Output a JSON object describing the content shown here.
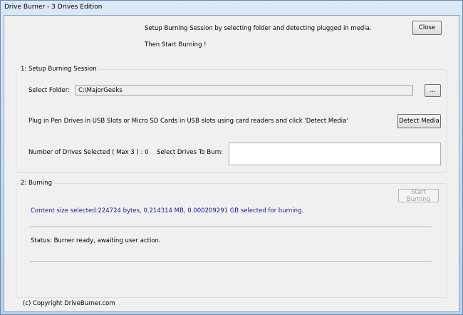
{
  "window": {
    "title": "Drive Burner - 3 Drives Edition"
  },
  "header": {
    "line1": "Setup Burning Session by selecting folder and detecting plugged in media.",
    "line2": "Then Start Burning !",
    "close_label": "Close"
  },
  "setup": {
    "group_label": "1: Setup Burning Session",
    "folder_label": "Select Folder:",
    "folder_value": "C:\\MajorGeeks",
    "browse_label": "...",
    "instructions": "Plug in Pen Drives in USB Slots or Micro SD Cards in USB slots using card readers and click 'Detect Media'",
    "detect_label": "Detect Media",
    "drives_count": "Number of Drives Selected ( Max 3 ) : 0",
    "drives_label": "Select Drives To Burn:"
  },
  "burning": {
    "group_label": "2: Burning",
    "start_label": "Start Burning",
    "content_size": "Content size selected:224724 bytes, 0.214314 MB, 0.000209291 GB selected for burning.",
    "status": "Status: Burner ready, awaiting user action.",
    "info_color": "#1a1a8c"
  },
  "footer": {
    "copyright": "(c) Copyright DriveBurner.com"
  }
}
